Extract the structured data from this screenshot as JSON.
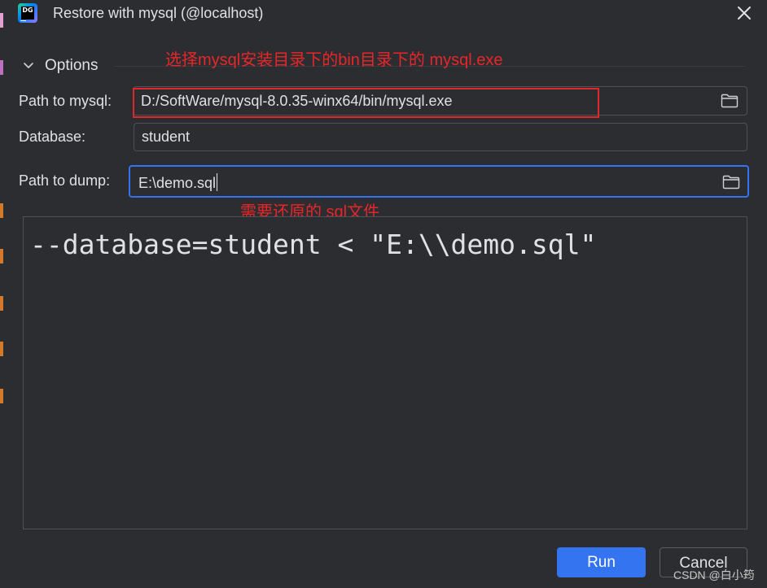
{
  "window": {
    "title": "Restore with mysql (@localhost)",
    "app_icon_text": "DG"
  },
  "options": {
    "section_label": "Options"
  },
  "annotations": {
    "mysql_path_hint": "选择mysql安装目录下的bin目录下的 mysql.exe",
    "dump_hint": "需要还原的 sql文件"
  },
  "fields": {
    "mysql_path": {
      "label": "Path to mysql:",
      "value": "D:/SoftWare/mysql-8.0.35-winx64/bin/mysql.exe"
    },
    "database": {
      "label": "Database:",
      "value": "student"
    },
    "dump_path": {
      "label": "Path to dump:",
      "value": "E:\\demo.sql"
    }
  },
  "command_preview": "--database=student < \"E:\\\\demo.sql\"",
  "buttons": {
    "run": "Run",
    "cancel": "Cancel"
  },
  "watermark": "CSDN @白小筠",
  "colors": {
    "background": "#2b2d30",
    "accent": "#3574f0",
    "annotation_red": "#e8262a"
  },
  "icons": {
    "close": "close-icon",
    "chevron": "chevron-down-icon",
    "folder": "folder-icon"
  }
}
